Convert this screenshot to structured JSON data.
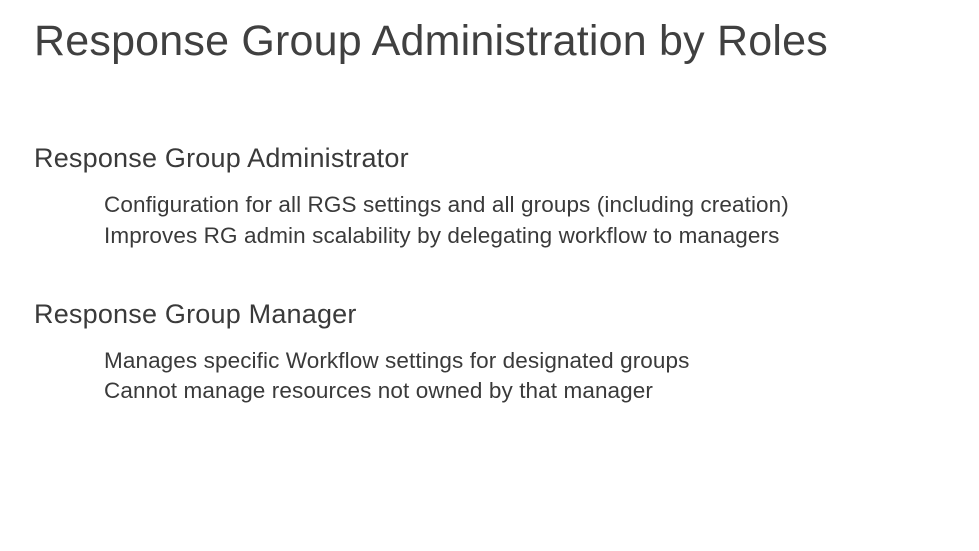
{
  "title": "Response Group Administration by Roles",
  "sections": [
    {
      "heading": "Response Group Administrator",
      "lines": [
        "Configuration for all RGS settings and all groups (including creation)",
        "Improves RG admin scalability by delegating workflow to managers"
      ]
    },
    {
      "heading": "Response Group Manager",
      "lines": [
        "Manages specific Workflow settings for designated groups",
        "Cannot manage resources not owned by that manager"
      ]
    }
  ]
}
